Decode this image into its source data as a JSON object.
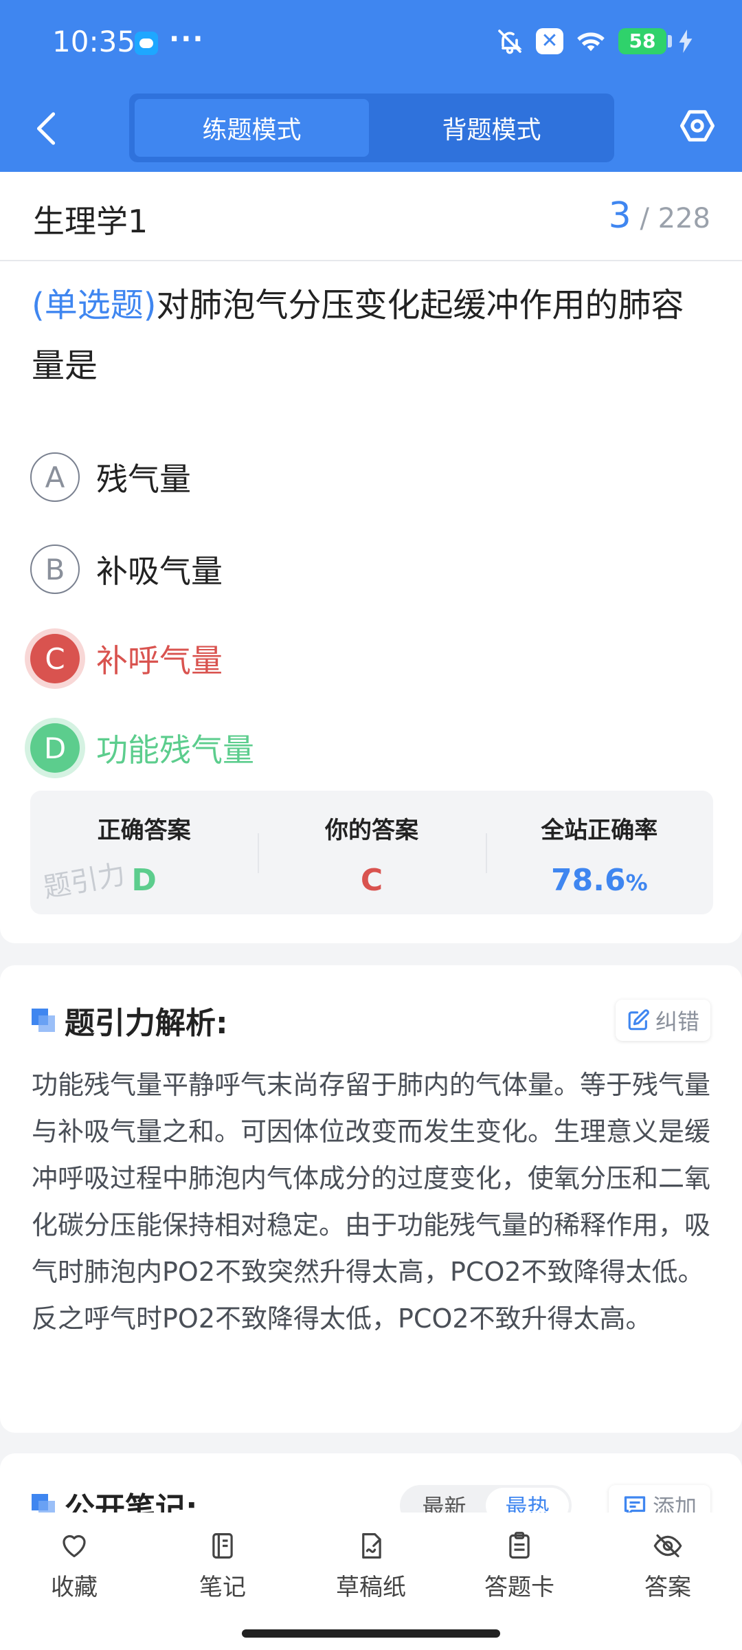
{
  "status_bar": {
    "time": "10:35",
    "battery": "58"
  },
  "nav": {
    "modes": [
      "练题模式",
      "背题模式"
    ]
  },
  "subject": {
    "title": "生理学1",
    "current": "3",
    "total": "/ 228"
  },
  "question": {
    "type": "(单选题)",
    "text": "对肺泡气分压变化起缓冲作用的肺容量是",
    "options": [
      {
        "letter": "A",
        "text": "残气量"
      },
      {
        "letter": "B",
        "text": "补吸气量"
      },
      {
        "letter": "C",
        "text": "补呼气量"
      },
      {
        "letter": "D",
        "text": "功能残气量"
      }
    ]
  },
  "stats": {
    "correct_label": "正确答案",
    "correct_value": "D",
    "yours_label": "你的答案",
    "yours_value": "C",
    "rate_label": "全站正确率",
    "rate_value": "78.6",
    "rate_unit": "%"
  },
  "watermark": "题引力",
  "analysis": {
    "title": "题引力解析:",
    "correct_button": "纠错",
    "text": "功能残气量平静呼气末尚存留于肺内的气体量。等于残气量与补吸气量之和。可因体位改变而发生变化。生理意义是缓冲呼吸过程中肺泡内气体成分的过度变化，使氧分压和二氧化碳分压能保持相对稳定。由于功能残气量的稀释作用，吸气时肺泡内PO2不致突然升得太高，PCO2不致降得太低。反之呼气时PO2不致降得太低，PCO2不致升得太高。"
  },
  "notes": {
    "title": "公开笔记:",
    "sort_options": [
      "最新",
      "最热"
    ],
    "add_button": "添加"
  },
  "bottom_tabs": [
    "收藏",
    "笔记",
    "草稿纸",
    "答题卡",
    "答案"
  ],
  "colors": {
    "primary": "#3f86f0",
    "wrong": "#d9534f",
    "correct": "#5ccd8d"
  }
}
